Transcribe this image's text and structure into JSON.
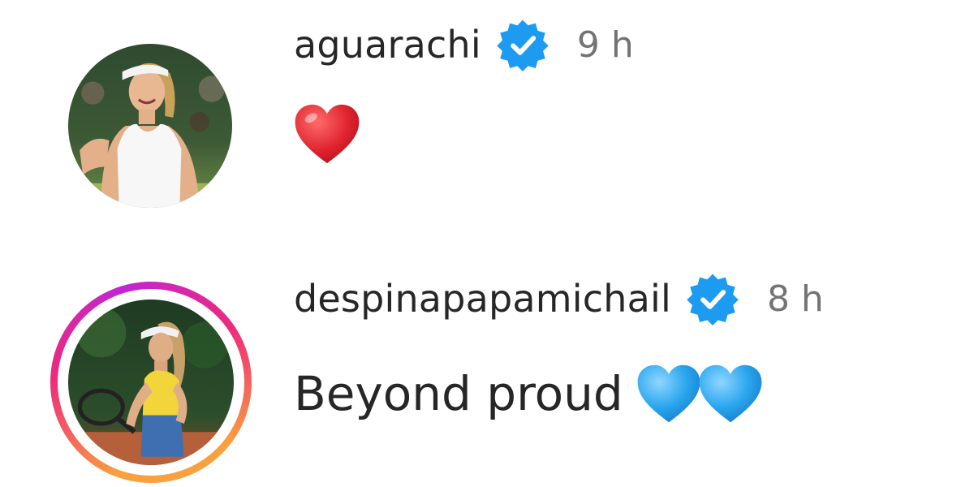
{
  "comments": [
    {
      "username": "aguarachi",
      "verified": true,
      "timestamp": "9 h",
      "text": "",
      "emojis": [
        "red-heart"
      ],
      "avatar_has_story_ring": false
    },
    {
      "username": "despinapapamichail",
      "verified": true,
      "timestamp": "8 h",
      "text": "Beyond proud",
      "emojis": [
        "blue-heart",
        "blue-heart"
      ],
      "avatar_has_story_ring": true
    }
  ],
  "colors": {
    "verified_badge": "#1d9bf0",
    "story_ring_start": "#f9a03f",
    "story_ring_end": "#c026d3",
    "username_text": "#262626",
    "timestamp_text": "#737373",
    "red_heart": "#e0242f",
    "blue_heart": "#2aa6ee"
  }
}
